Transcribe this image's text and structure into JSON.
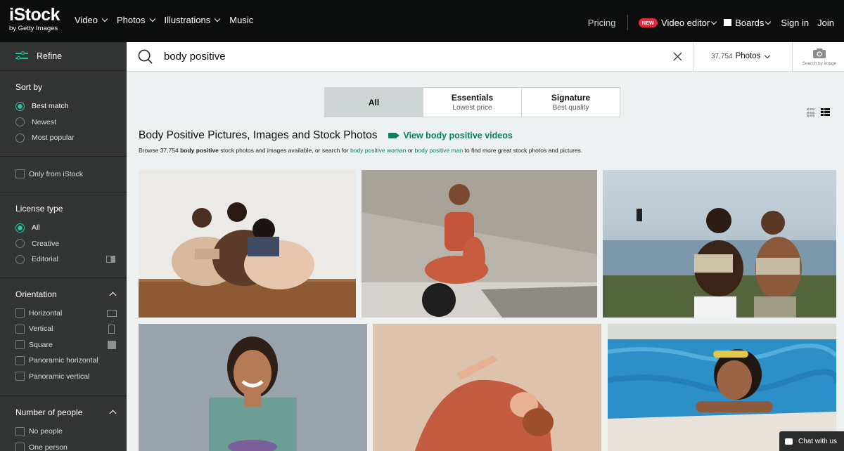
{
  "header": {
    "logo_main": "iStock",
    "logo_sub": "by Getty Images",
    "nav": [
      "Video",
      "Photos",
      "Illustrations",
      "Music"
    ],
    "pricing": "Pricing",
    "new_badge": "NEW",
    "video_editor": "Video editor",
    "boards": "Boards",
    "sign_in": "Sign in",
    "join": "Join"
  },
  "sidebar": {
    "refine": "Refine",
    "sort_by": {
      "title": "Sort by",
      "options": [
        "Best match",
        "Newest",
        "Most popular"
      ],
      "selected": "Best match"
    },
    "only_from_istock": "Only from iStock",
    "license_type": {
      "title": "License type",
      "options": [
        "All",
        "Creative",
        "Editorial"
      ],
      "selected": "All"
    },
    "orientation": {
      "title": "Orientation",
      "options": [
        "Horizontal",
        "Vertical",
        "Square",
        "Panoramic horizontal",
        "Panoramic vertical"
      ]
    },
    "number_of_people": {
      "title": "Number of people",
      "options": [
        "No people",
        "One person"
      ]
    }
  },
  "search": {
    "query": "body positive",
    "count": "37,754",
    "media_type": "Photos",
    "search_by_image": "Search by image"
  },
  "tabs": [
    {
      "label": "All",
      "sub": ""
    },
    {
      "label": "Essentials",
      "sub": "Lowest price"
    },
    {
      "label": "Signature",
      "sub": "Best quality"
    }
  ],
  "results": {
    "heading": "Body Positive Pictures, Images and Stock Photos",
    "videos_link": "View body positive videos",
    "desc_prefix": "Browse 37,754 ",
    "desc_term": "body positive",
    "desc_mid": " stock photos and images available, or search for ",
    "desc_link1": "body positive woman",
    "desc_or": " or ",
    "desc_link2": "body positive man",
    "desc_suffix": " to find more great stock photos and pictures."
  },
  "chat": "Chat with us",
  "colors": {
    "accent": "#07815e",
    "topnav": "#0c0d0d",
    "sidebar": "#333535",
    "new_badge": "#e8283b"
  },
  "icons": [
    "refine-sliders-icon",
    "search-icon",
    "clear-icon",
    "camera-icon",
    "grid-view-icon",
    "mosaic-view-icon",
    "video-camera-icon",
    "chat-icon",
    "board-icon"
  ]
}
